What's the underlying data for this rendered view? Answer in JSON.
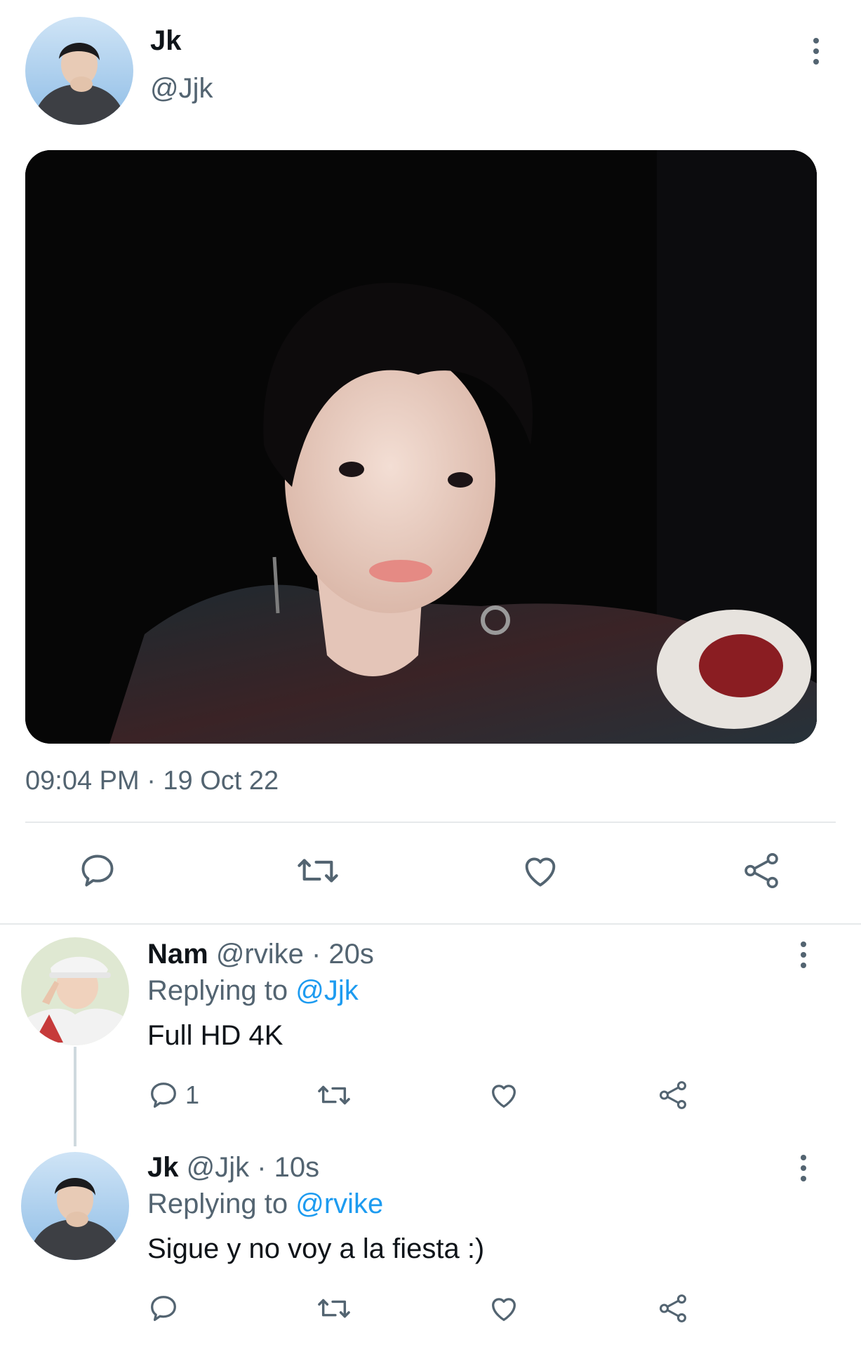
{
  "tweet": {
    "name": "Jk",
    "handle": "@Jjk",
    "timestamp": "09:04 PM · 19 Oct 22",
    "actions": {
      "reply_icon": "reply-icon",
      "retweet_icon": "retweet-icon",
      "like_icon": "heart-icon",
      "share_icon": "share-icon"
    }
  },
  "replies": [
    {
      "name": "Nam",
      "handle_time": "@rvike · 20s",
      "replying_prefix": "Replying to ",
      "replying_to": "@Jjk",
      "text": "Full HD 4K",
      "reply_count": "1"
    },
    {
      "name": "Jk",
      "handle_time": "@Jjk · 10s",
      "replying_prefix": "Replying to ",
      "replying_to": "@rvike",
      "text": "Sigue y no voy a la fiesta :)",
      "reply_count": ""
    }
  ],
  "colors": {
    "text_primary": "#0f1419",
    "text_secondary": "#536471",
    "accent": "#1d9bf0",
    "divider": "#e6e9eb"
  }
}
